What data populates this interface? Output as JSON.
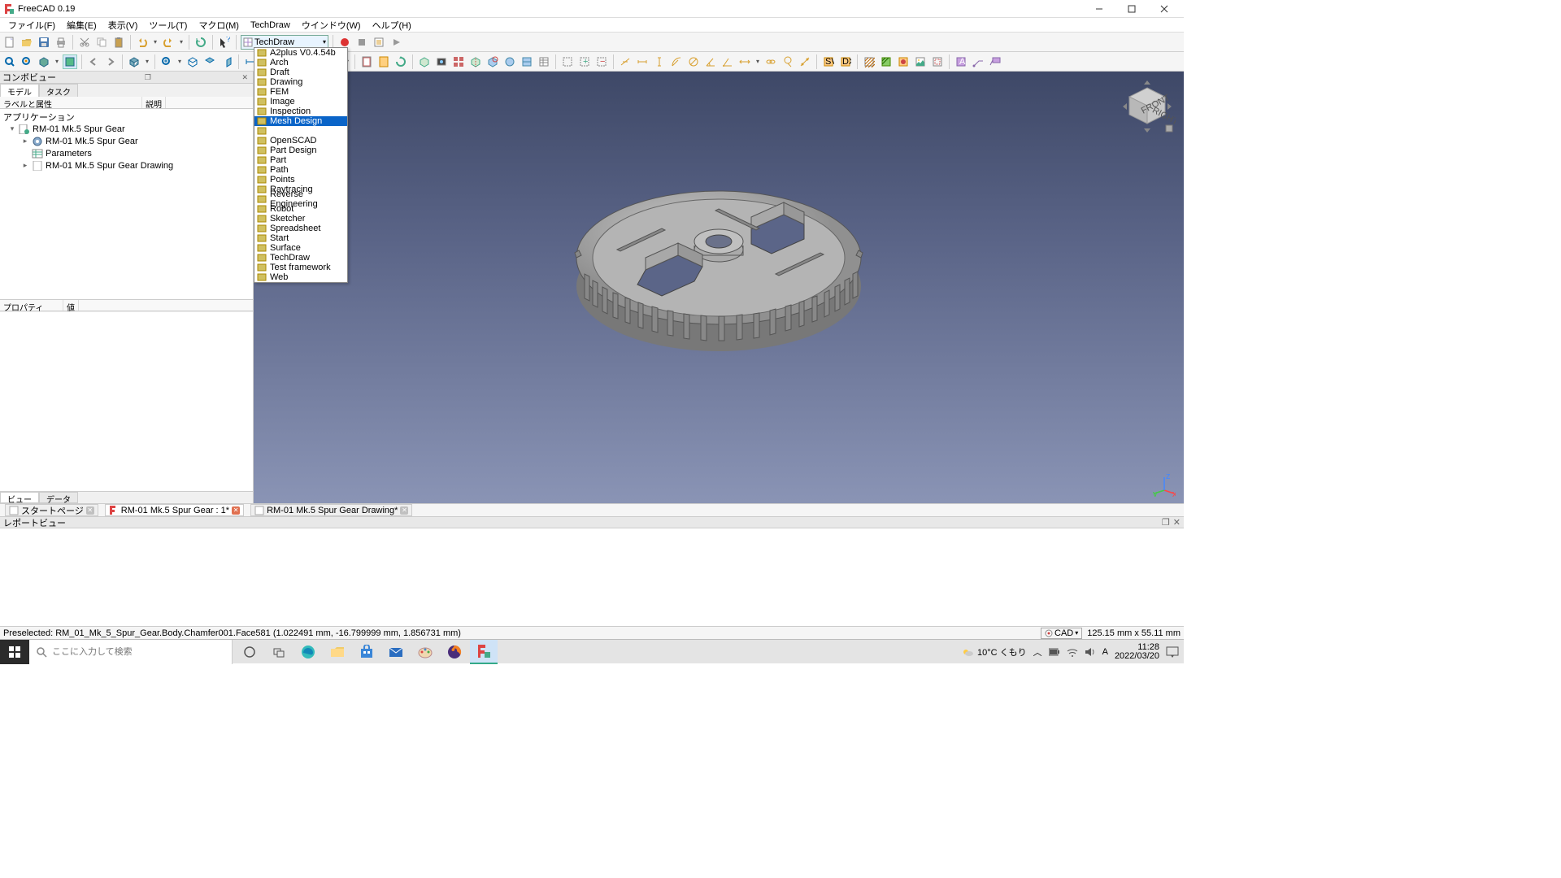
{
  "title": "FreeCAD 0.19",
  "menus": [
    "ファイル(F)",
    "編集(E)",
    "表示(V)",
    "ツール(T)",
    "マクロ(M)",
    "TechDraw",
    "ウインドウ(W)",
    "ヘルプ(H)"
  ],
  "workbench_selected": "TechDraw",
  "workbench_list": [
    "A2plus  V0.4.54b",
    "Arch",
    "Draft",
    "Drawing",
    "FEM",
    "Image",
    "Inspection",
    "Mesh Design",
    "<none>",
    "OpenSCAD",
    "Part Design",
    "Part",
    "Path",
    "Points",
    "Raytracing",
    "Reverse Engineering",
    "Robot",
    "Sketcher",
    "Spreadsheet",
    "Start",
    "Surface",
    "TechDraw",
    "Test framework",
    "Web"
  ],
  "workbench_highlight": "Mesh Design",
  "combo_title": "コンボビュー",
  "combo_tabs": [
    "モデル",
    "タスク"
  ],
  "tree_headers": [
    "ラベルと属性",
    "説明"
  ],
  "tree_app": "アプリケーション",
  "tree": [
    {
      "indent": 0,
      "exp": "▾",
      "icon": "doc",
      "label": "RM-01 Mk.5 Spur Gear"
    },
    {
      "indent": 1,
      "exp": "▸",
      "icon": "gear",
      "label": "RM-01 Mk.5 Spur Gear"
    },
    {
      "indent": 1,
      "exp": "",
      "icon": "sheet",
      "label": "Parameters"
    },
    {
      "indent": 1,
      "exp": "▸",
      "icon": "page",
      "label": "RM-01 Mk.5 Spur Gear Drawing"
    }
  ],
  "prop_headers": [
    "プロパティ",
    "値"
  ],
  "prop_tabs": [
    "ビュー",
    "データ"
  ],
  "doc_tabs": [
    {
      "label": "スタートページ",
      "close": true,
      "active": false
    },
    {
      "label": "RM-01 Mk.5 Spur Gear : 1*",
      "close": true,
      "active": true,
      "closeRed": true
    },
    {
      "label": "RM-01 Mk.5 Spur Gear Drawing*",
      "close": true,
      "active": false
    }
  ],
  "report_title": "レポートビュー",
  "status_left": "Preselected: RM_01_Mk_5_Spur_Gear.Body.Chamfer001.Face581 (1.022491 mm, -16.799999 mm, 1.856731 mm)",
  "status_mode": "CAD",
  "status_dims": "125.15 mm x 55.11 mm",
  "taskbar": {
    "search_placeholder": "ここに入力して検索",
    "weather": "10°C  くもり",
    "time": "11:28",
    "date": "2022/03/20"
  }
}
